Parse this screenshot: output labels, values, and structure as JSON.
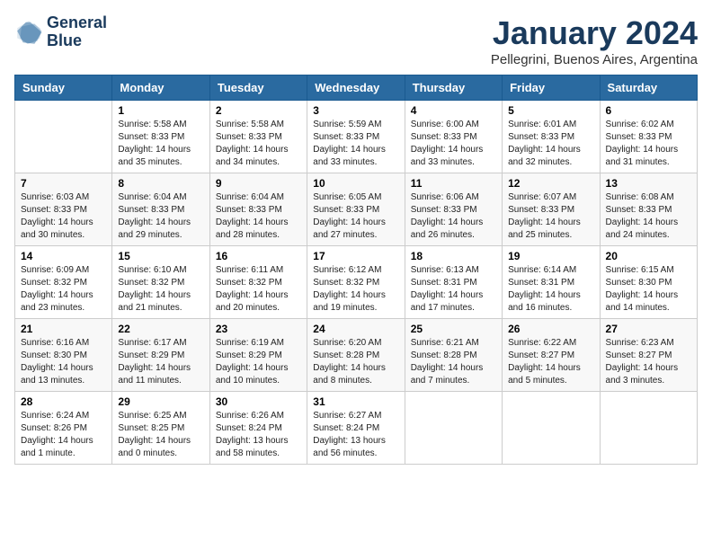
{
  "logo": {
    "line1": "General",
    "line2": "Blue"
  },
  "title": "January 2024",
  "subtitle": "Pellegrini, Buenos Aires, Argentina",
  "headers": [
    "Sunday",
    "Monday",
    "Tuesday",
    "Wednesday",
    "Thursday",
    "Friday",
    "Saturday"
  ],
  "weeks": [
    [
      {
        "day": "",
        "info": ""
      },
      {
        "day": "1",
        "info": "Sunrise: 5:58 AM\nSunset: 8:33 PM\nDaylight: 14 hours\nand 35 minutes."
      },
      {
        "day": "2",
        "info": "Sunrise: 5:58 AM\nSunset: 8:33 PM\nDaylight: 14 hours\nand 34 minutes."
      },
      {
        "day": "3",
        "info": "Sunrise: 5:59 AM\nSunset: 8:33 PM\nDaylight: 14 hours\nand 33 minutes."
      },
      {
        "day": "4",
        "info": "Sunrise: 6:00 AM\nSunset: 8:33 PM\nDaylight: 14 hours\nand 33 minutes."
      },
      {
        "day": "5",
        "info": "Sunrise: 6:01 AM\nSunset: 8:33 PM\nDaylight: 14 hours\nand 32 minutes."
      },
      {
        "day": "6",
        "info": "Sunrise: 6:02 AM\nSunset: 8:33 PM\nDaylight: 14 hours\nand 31 minutes."
      }
    ],
    [
      {
        "day": "7",
        "info": "Sunrise: 6:03 AM\nSunset: 8:33 PM\nDaylight: 14 hours\nand 30 minutes."
      },
      {
        "day": "8",
        "info": "Sunrise: 6:04 AM\nSunset: 8:33 PM\nDaylight: 14 hours\nand 29 minutes."
      },
      {
        "day": "9",
        "info": "Sunrise: 6:04 AM\nSunset: 8:33 PM\nDaylight: 14 hours\nand 28 minutes."
      },
      {
        "day": "10",
        "info": "Sunrise: 6:05 AM\nSunset: 8:33 PM\nDaylight: 14 hours\nand 27 minutes."
      },
      {
        "day": "11",
        "info": "Sunrise: 6:06 AM\nSunset: 8:33 PM\nDaylight: 14 hours\nand 26 minutes."
      },
      {
        "day": "12",
        "info": "Sunrise: 6:07 AM\nSunset: 8:33 PM\nDaylight: 14 hours\nand 25 minutes."
      },
      {
        "day": "13",
        "info": "Sunrise: 6:08 AM\nSunset: 8:33 PM\nDaylight: 14 hours\nand 24 minutes."
      }
    ],
    [
      {
        "day": "14",
        "info": "Sunrise: 6:09 AM\nSunset: 8:32 PM\nDaylight: 14 hours\nand 23 minutes."
      },
      {
        "day": "15",
        "info": "Sunrise: 6:10 AM\nSunset: 8:32 PM\nDaylight: 14 hours\nand 21 minutes."
      },
      {
        "day": "16",
        "info": "Sunrise: 6:11 AM\nSunset: 8:32 PM\nDaylight: 14 hours\nand 20 minutes."
      },
      {
        "day": "17",
        "info": "Sunrise: 6:12 AM\nSunset: 8:32 PM\nDaylight: 14 hours\nand 19 minutes."
      },
      {
        "day": "18",
        "info": "Sunrise: 6:13 AM\nSunset: 8:31 PM\nDaylight: 14 hours\nand 17 minutes."
      },
      {
        "day": "19",
        "info": "Sunrise: 6:14 AM\nSunset: 8:31 PM\nDaylight: 14 hours\nand 16 minutes."
      },
      {
        "day": "20",
        "info": "Sunrise: 6:15 AM\nSunset: 8:30 PM\nDaylight: 14 hours\nand 14 minutes."
      }
    ],
    [
      {
        "day": "21",
        "info": "Sunrise: 6:16 AM\nSunset: 8:30 PM\nDaylight: 14 hours\nand 13 minutes."
      },
      {
        "day": "22",
        "info": "Sunrise: 6:17 AM\nSunset: 8:29 PM\nDaylight: 14 hours\nand 11 minutes."
      },
      {
        "day": "23",
        "info": "Sunrise: 6:19 AM\nSunset: 8:29 PM\nDaylight: 14 hours\nand 10 minutes."
      },
      {
        "day": "24",
        "info": "Sunrise: 6:20 AM\nSunset: 8:28 PM\nDaylight: 14 hours\nand 8 minutes."
      },
      {
        "day": "25",
        "info": "Sunrise: 6:21 AM\nSunset: 8:28 PM\nDaylight: 14 hours\nand 7 minutes."
      },
      {
        "day": "26",
        "info": "Sunrise: 6:22 AM\nSunset: 8:27 PM\nDaylight: 14 hours\nand 5 minutes."
      },
      {
        "day": "27",
        "info": "Sunrise: 6:23 AM\nSunset: 8:27 PM\nDaylight: 14 hours\nand 3 minutes."
      }
    ],
    [
      {
        "day": "28",
        "info": "Sunrise: 6:24 AM\nSunset: 8:26 PM\nDaylight: 14 hours\nand 1 minute."
      },
      {
        "day": "29",
        "info": "Sunrise: 6:25 AM\nSunset: 8:25 PM\nDaylight: 14 hours\nand 0 minutes."
      },
      {
        "day": "30",
        "info": "Sunrise: 6:26 AM\nSunset: 8:24 PM\nDaylight: 13 hours\nand 58 minutes."
      },
      {
        "day": "31",
        "info": "Sunrise: 6:27 AM\nSunset: 8:24 PM\nDaylight: 13 hours\nand 56 minutes."
      },
      {
        "day": "",
        "info": ""
      },
      {
        "day": "",
        "info": ""
      },
      {
        "day": "",
        "info": ""
      }
    ]
  ]
}
